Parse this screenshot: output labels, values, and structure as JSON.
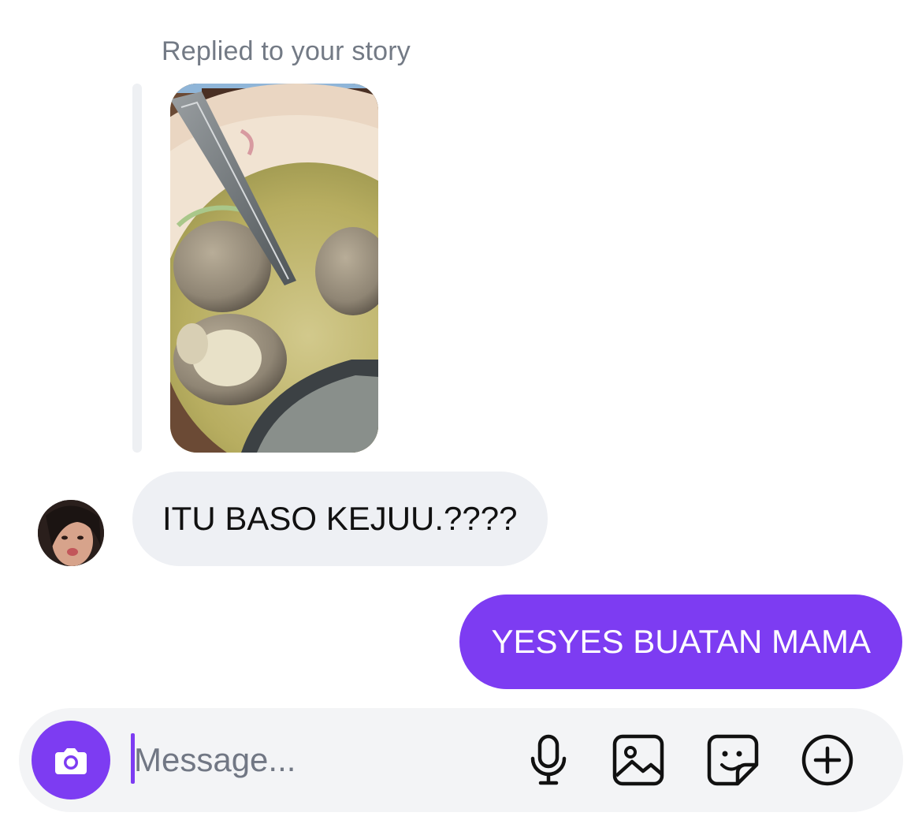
{
  "thread": {
    "reply_label": "Replied to your story",
    "incoming_message": "ITU BASO KEJUU.????",
    "outgoing_message": "YESYES BUATAN MAMA"
  },
  "composer": {
    "placeholder": "Message..."
  },
  "icons": {
    "camera": "camera-icon",
    "mic": "microphone-icon",
    "gallery": "image-icon",
    "sticker": "sticker-icon",
    "more": "plus-circle-icon"
  },
  "colors": {
    "accent": "#7d3cf2",
    "incoming_bubble": "#eef0f4",
    "composer_bg": "#f3f4f6",
    "label_gray": "#737a85"
  }
}
